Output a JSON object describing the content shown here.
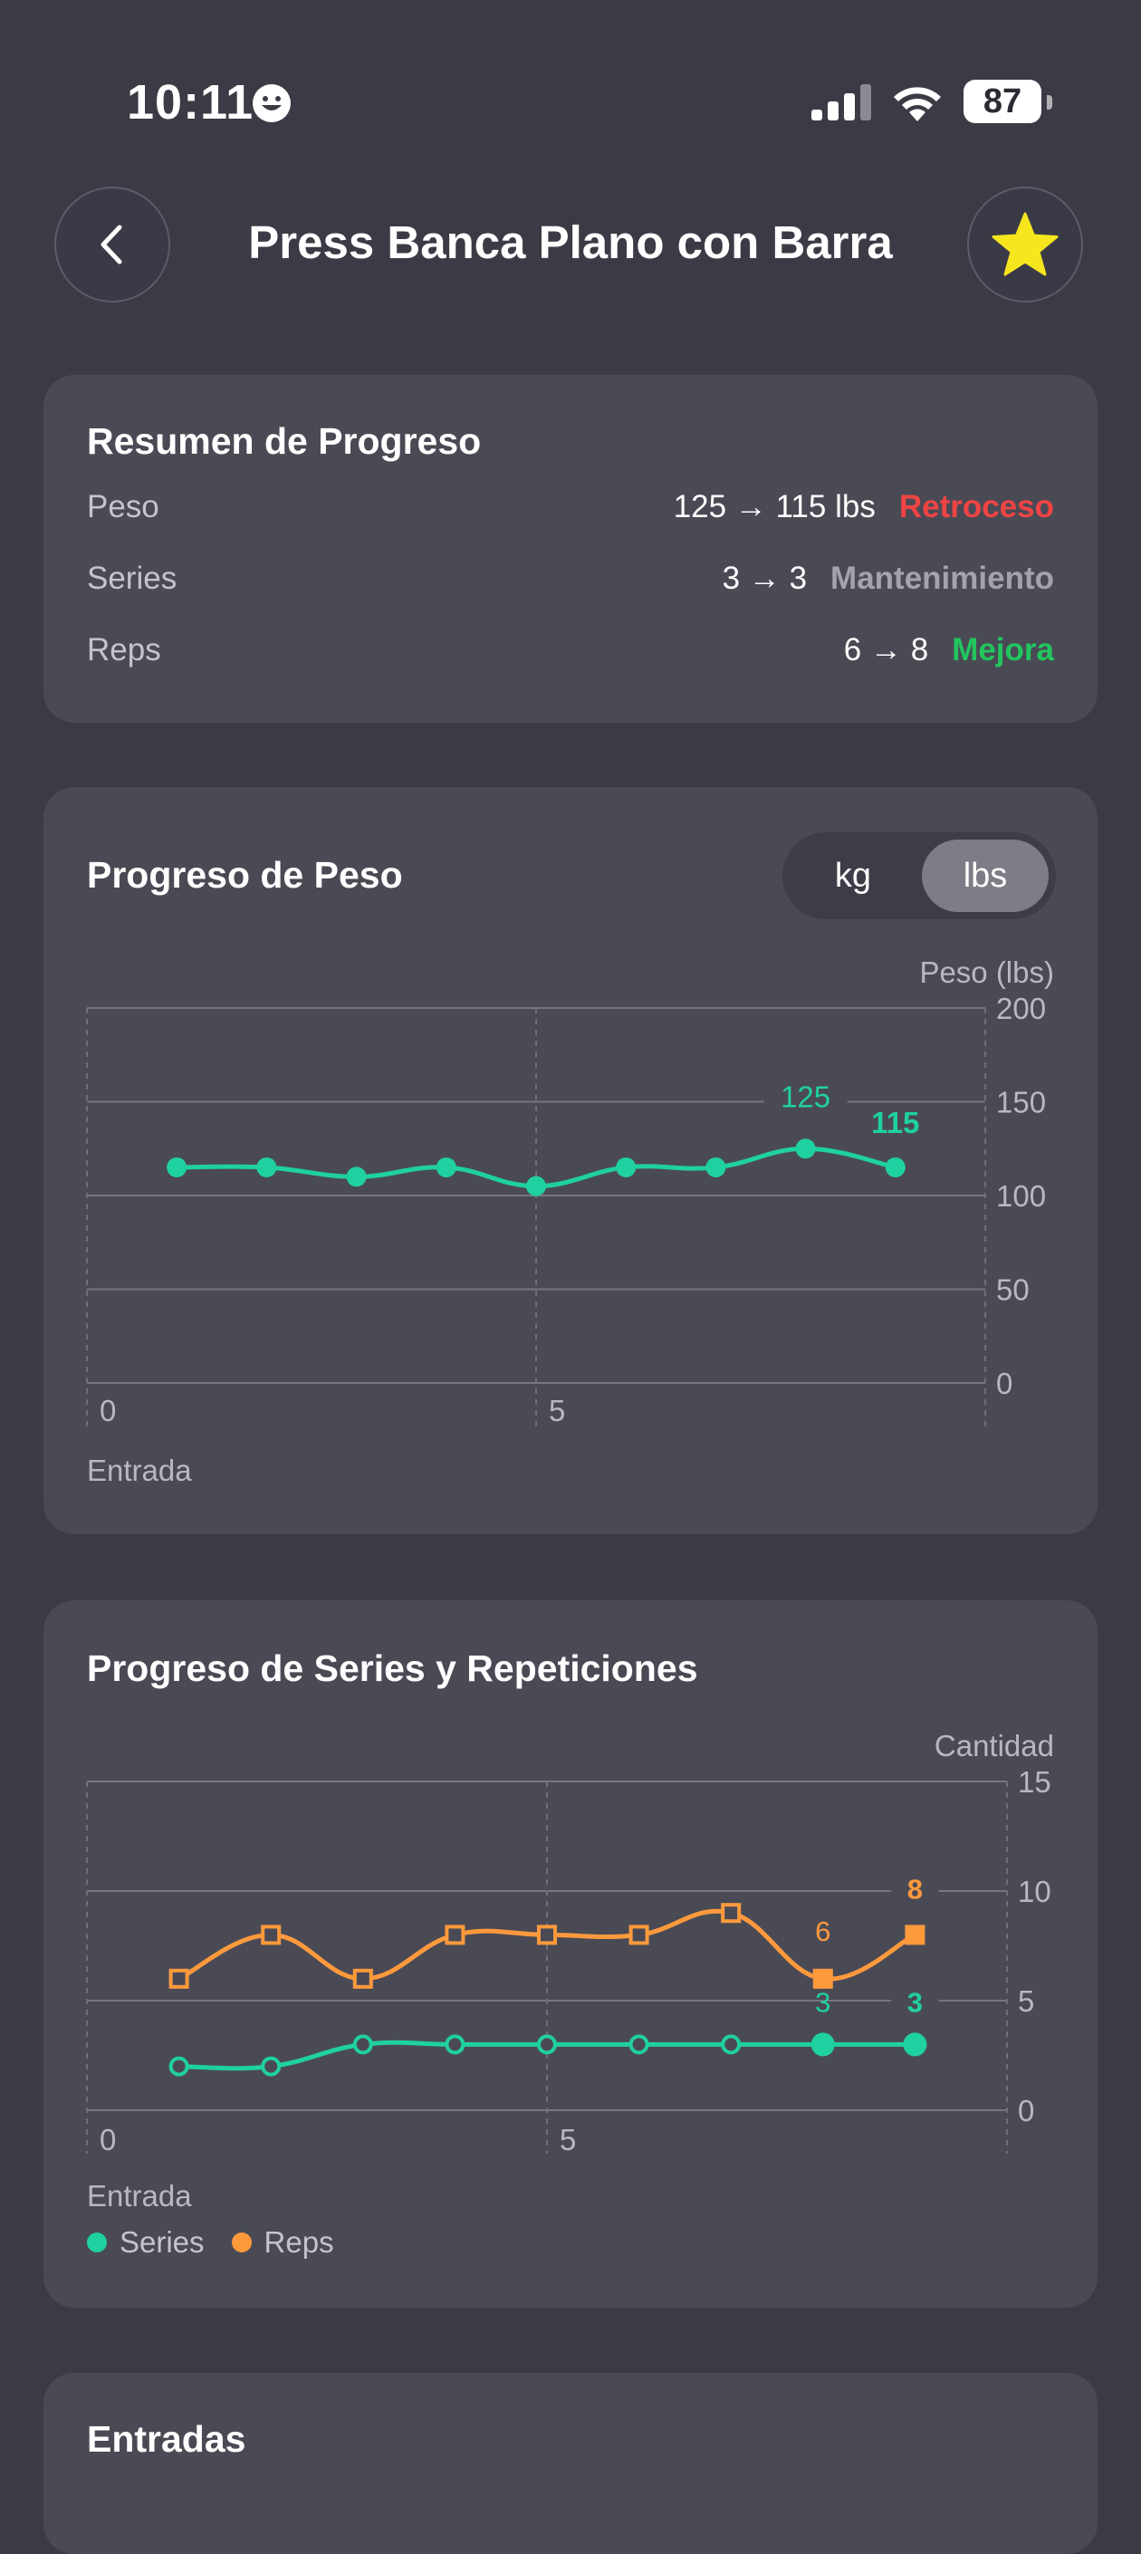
{
  "status_bar": {
    "time": "10:11",
    "battery": "87"
  },
  "header": {
    "title": "Press Banca Plano con Barra",
    "back_icon": "chevron-left-icon",
    "favorite_icon": "star-icon"
  },
  "colors": {
    "teal": "#1fd1a0",
    "orange": "#ff9a3c",
    "red": "#ef4444",
    "green": "#22c55e",
    "star": "#f5e61e"
  },
  "summary": {
    "title": "Resumen de Progreso",
    "rows": [
      {
        "label": "Peso",
        "value": "125 → 115 lbs",
        "status": "Retroceso"
      },
      {
        "label": "Series",
        "value": "3 → 3",
        "status": "Mantenimiento"
      },
      {
        "label": "Reps",
        "value": "6 → 8",
        "status": "Mejora"
      }
    ]
  },
  "weight_card": {
    "title": "Progreso de Peso",
    "toggle": {
      "kg": "kg",
      "lbs": "lbs",
      "selected": "lbs"
    }
  },
  "sets_card": {
    "title": "Progreso de Series y Repeticiones",
    "legend": [
      "Series",
      "Reps"
    ]
  },
  "entries_card": {
    "title": "Entradas"
  },
  "chart_data": [
    {
      "type": "line",
      "ylabel": "Peso (lbs)",
      "xlabel": "Entrada",
      "ylim": [
        0,
        200
      ],
      "xlim": [
        0,
        10
      ],
      "yticks": [
        0,
        50,
        100,
        150,
        200
      ],
      "xticks": [
        0,
        5
      ],
      "grid": true,
      "series": [
        {
          "x": [
            1,
            2,
            3,
            4,
            5,
            6,
            7,
            8,
            9
          ],
          "values": [
            115,
            115,
            110,
            115,
            105,
            115,
            115,
            125,
            115
          ]
        }
      ],
      "annotations": [
        {
          "x": 8,
          "y": 125,
          "text": "125"
        },
        {
          "x": 9,
          "y": 115,
          "text": "115"
        }
      ]
    },
    {
      "type": "line",
      "ylabel": "Cantidad",
      "xlabel": "Entrada",
      "ylim": [
        0,
        15
      ],
      "xlim": [
        0,
        10
      ],
      "yticks": [
        0,
        5,
        10,
        15
      ],
      "xticks": [
        0,
        5
      ],
      "grid": true,
      "legend": "bottom-left",
      "series": [
        {
          "name": "Series",
          "x": [
            1,
            2,
            3,
            4,
            5,
            6,
            7,
            8,
            9
          ],
          "values": [
            2,
            2,
            3,
            3,
            3,
            3,
            3,
            3,
            3
          ]
        },
        {
          "name": "Reps",
          "x": [
            1,
            2,
            3,
            4,
            5,
            6,
            7,
            8,
            9
          ],
          "values": [
            6,
            8,
            6,
            8,
            8,
            8,
            9,
            6,
            8
          ]
        }
      ],
      "annotations": [
        {
          "series": "Reps",
          "x": 8,
          "y": 6,
          "text": "6"
        },
        {
          "series": "Reps",
          "x": 9,
          "y": 8,
          "text": "8"
        },
        {
          "series": "Series",
          "x": 8,
          "y": 3,
          "text": "3"
        },
        {
          "series": "Series",
          "x": 9,
          "y": 3,
          "text": "3"
        }
      ]
    }
  ]
}
